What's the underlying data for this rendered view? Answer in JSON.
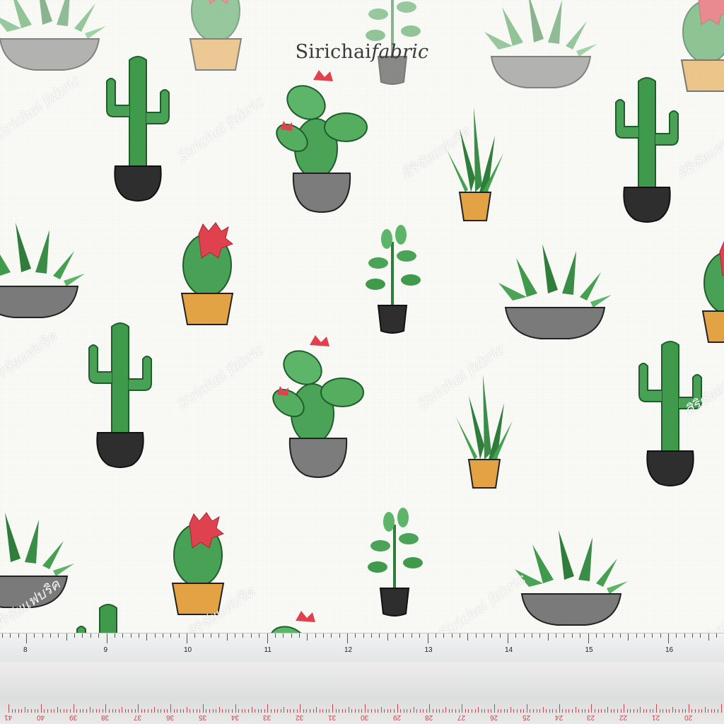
{
  "brand": {
    "name_plain": "Sirichai",
    "name_italic": "fabric"
  },
  "watermarks": {
    "latin": "Sirichai fabric",
    "thai": "ศิริชัยแฟบริค"
  },
  "ruler_top": {
    "labels": [
      "8",
      "9",
      "10",
      "11",
      "12",
      "13",
      "14",
      "15",
      "16"
    ]
  },
  "ruler_bottom": {
    "labels": [
      "41",
      "40",
      "39",
      "38",
      "37",
      "36",
      "35",
      "34",
      "33",
      "32",
      "31",
      "30",
      "29",
      "28",
      "27",
      "26",
      "25",
      "24",
      "23",
      "22",
      "21",
      "20"
    ]
  },
  "colors": {
    "cactus_green": "#3f9a4c",
    "dark_green": "#24703a",
    "flower_red": "#e0414f",
    "pot_black": "#2e2e2e",
    "pot_grey": "#6f6f6f",
    "pot_orange": "#e3a344",
    "ruler_red": "#c2464f"
  },
  "motifs": [
    "tall-cactus-black-pot",
    "prickly-pear-grey-pot",
    "snake-plant-orange-pot",
    "succulent-grey-bowl",
    "round-cactus-orange-pot",
    "jade-plant-black-pot"
  ]
}
